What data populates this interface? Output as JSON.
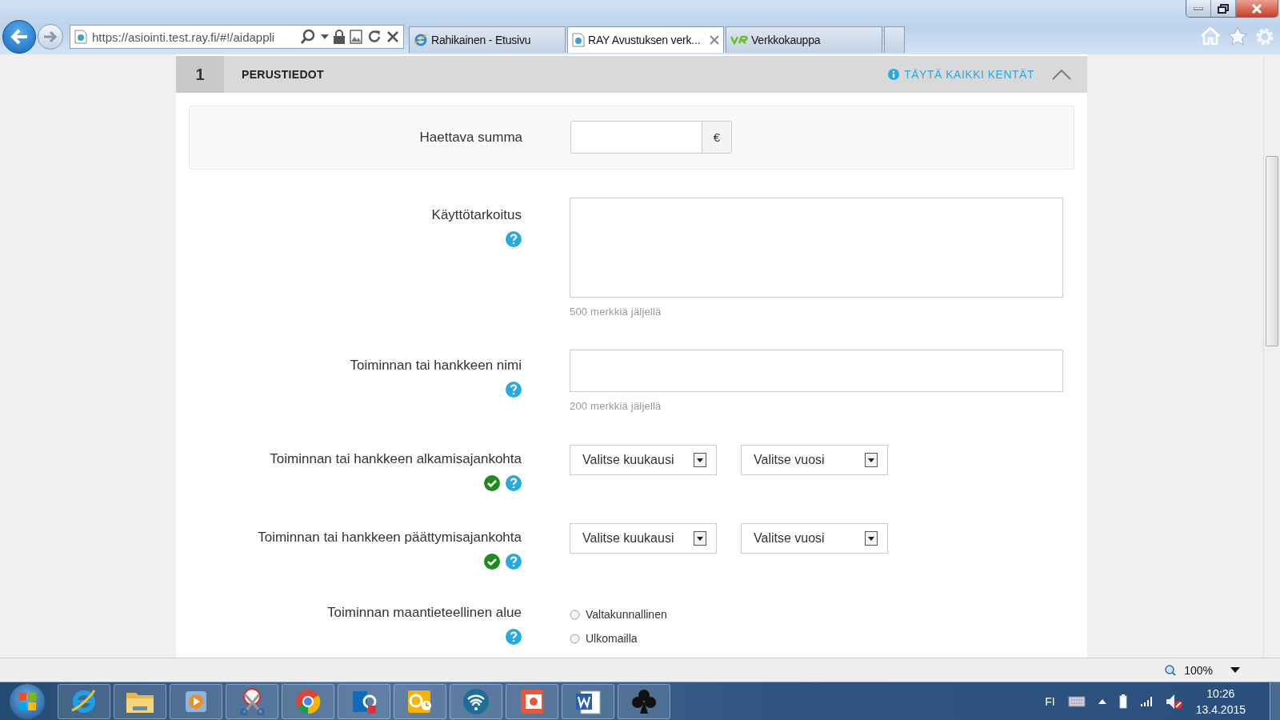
{
  "browser": {
    "address": "https://asiointi.test.ray.fi/#!/aidappli",
    "tabs": [
      {
        "title": "Rahikainen - Etusivu",
        "selected": false,
        "kind": "ie"
      },
      {
        "title": "RAY Avustuksen verk...",
        "selected": true,
        "kind": "page"
      },
      {
        "title": "Verkkokauppa",
        "selected": false,
        "kind": "vr"
      }
    ]
  },
  "section": {
    "number": "1",
    "title": "PERUSTIEDOT",
    "notice": "TÄYTÄ KAIKKI KENTÄT",
    "expanded": true,
    "fields": [
      {
        "kind": "amount",
        "label": "Haettava summa",
        "unit": "€",
        "help": false,
        "valid": false
      },
      {
        "kind": "textarea",
        "label": "Käyttötarkoitus",
        "counter": "500 merkkiä jäljellä",
        "help": true,
        "valid": false
      },
      {
        "kind": "text",
        "label": "Toiminnan tai hankkeen nimi",
        "counter": "200 merkkiä jäljellä",
        "help": true,
        "valid": false
      },
      {
        "kind": "date",
        "label": "Toiminnan tai hankkeen alkamisajankohta",
        "selects": [
          "Valitse kuukausi",
          "Valitse vuosi"
        ],
        "help": true,
        "valid": true
      },
      {
        "kind": "date",
        "label": "Toiminnan tai hankkeen päättymisajankohta",
        "selects": [
          "Valitse kuukausi",
          "Valitse vuosi"
        ],
        "help": true,
        "valid": true
      },
      {
        "kind": "radio",
        "label": "Toiminnan maantieteellinen alue",
        "help": true,
        "valid": false,
        "options": [
          {
            "label": "Valtakunnallinen",
            "selected": false
          },
          {
            "label": "Ulkomailla",
            "selected": false
          }
        ]
      }
    ]
  },
  "status_bar": {
    "zoom": "100%"
  },
  "taskbar": {
    "language": "FI",
    "time": "10:26",
    "date": "13.4.2015"
  }
}
